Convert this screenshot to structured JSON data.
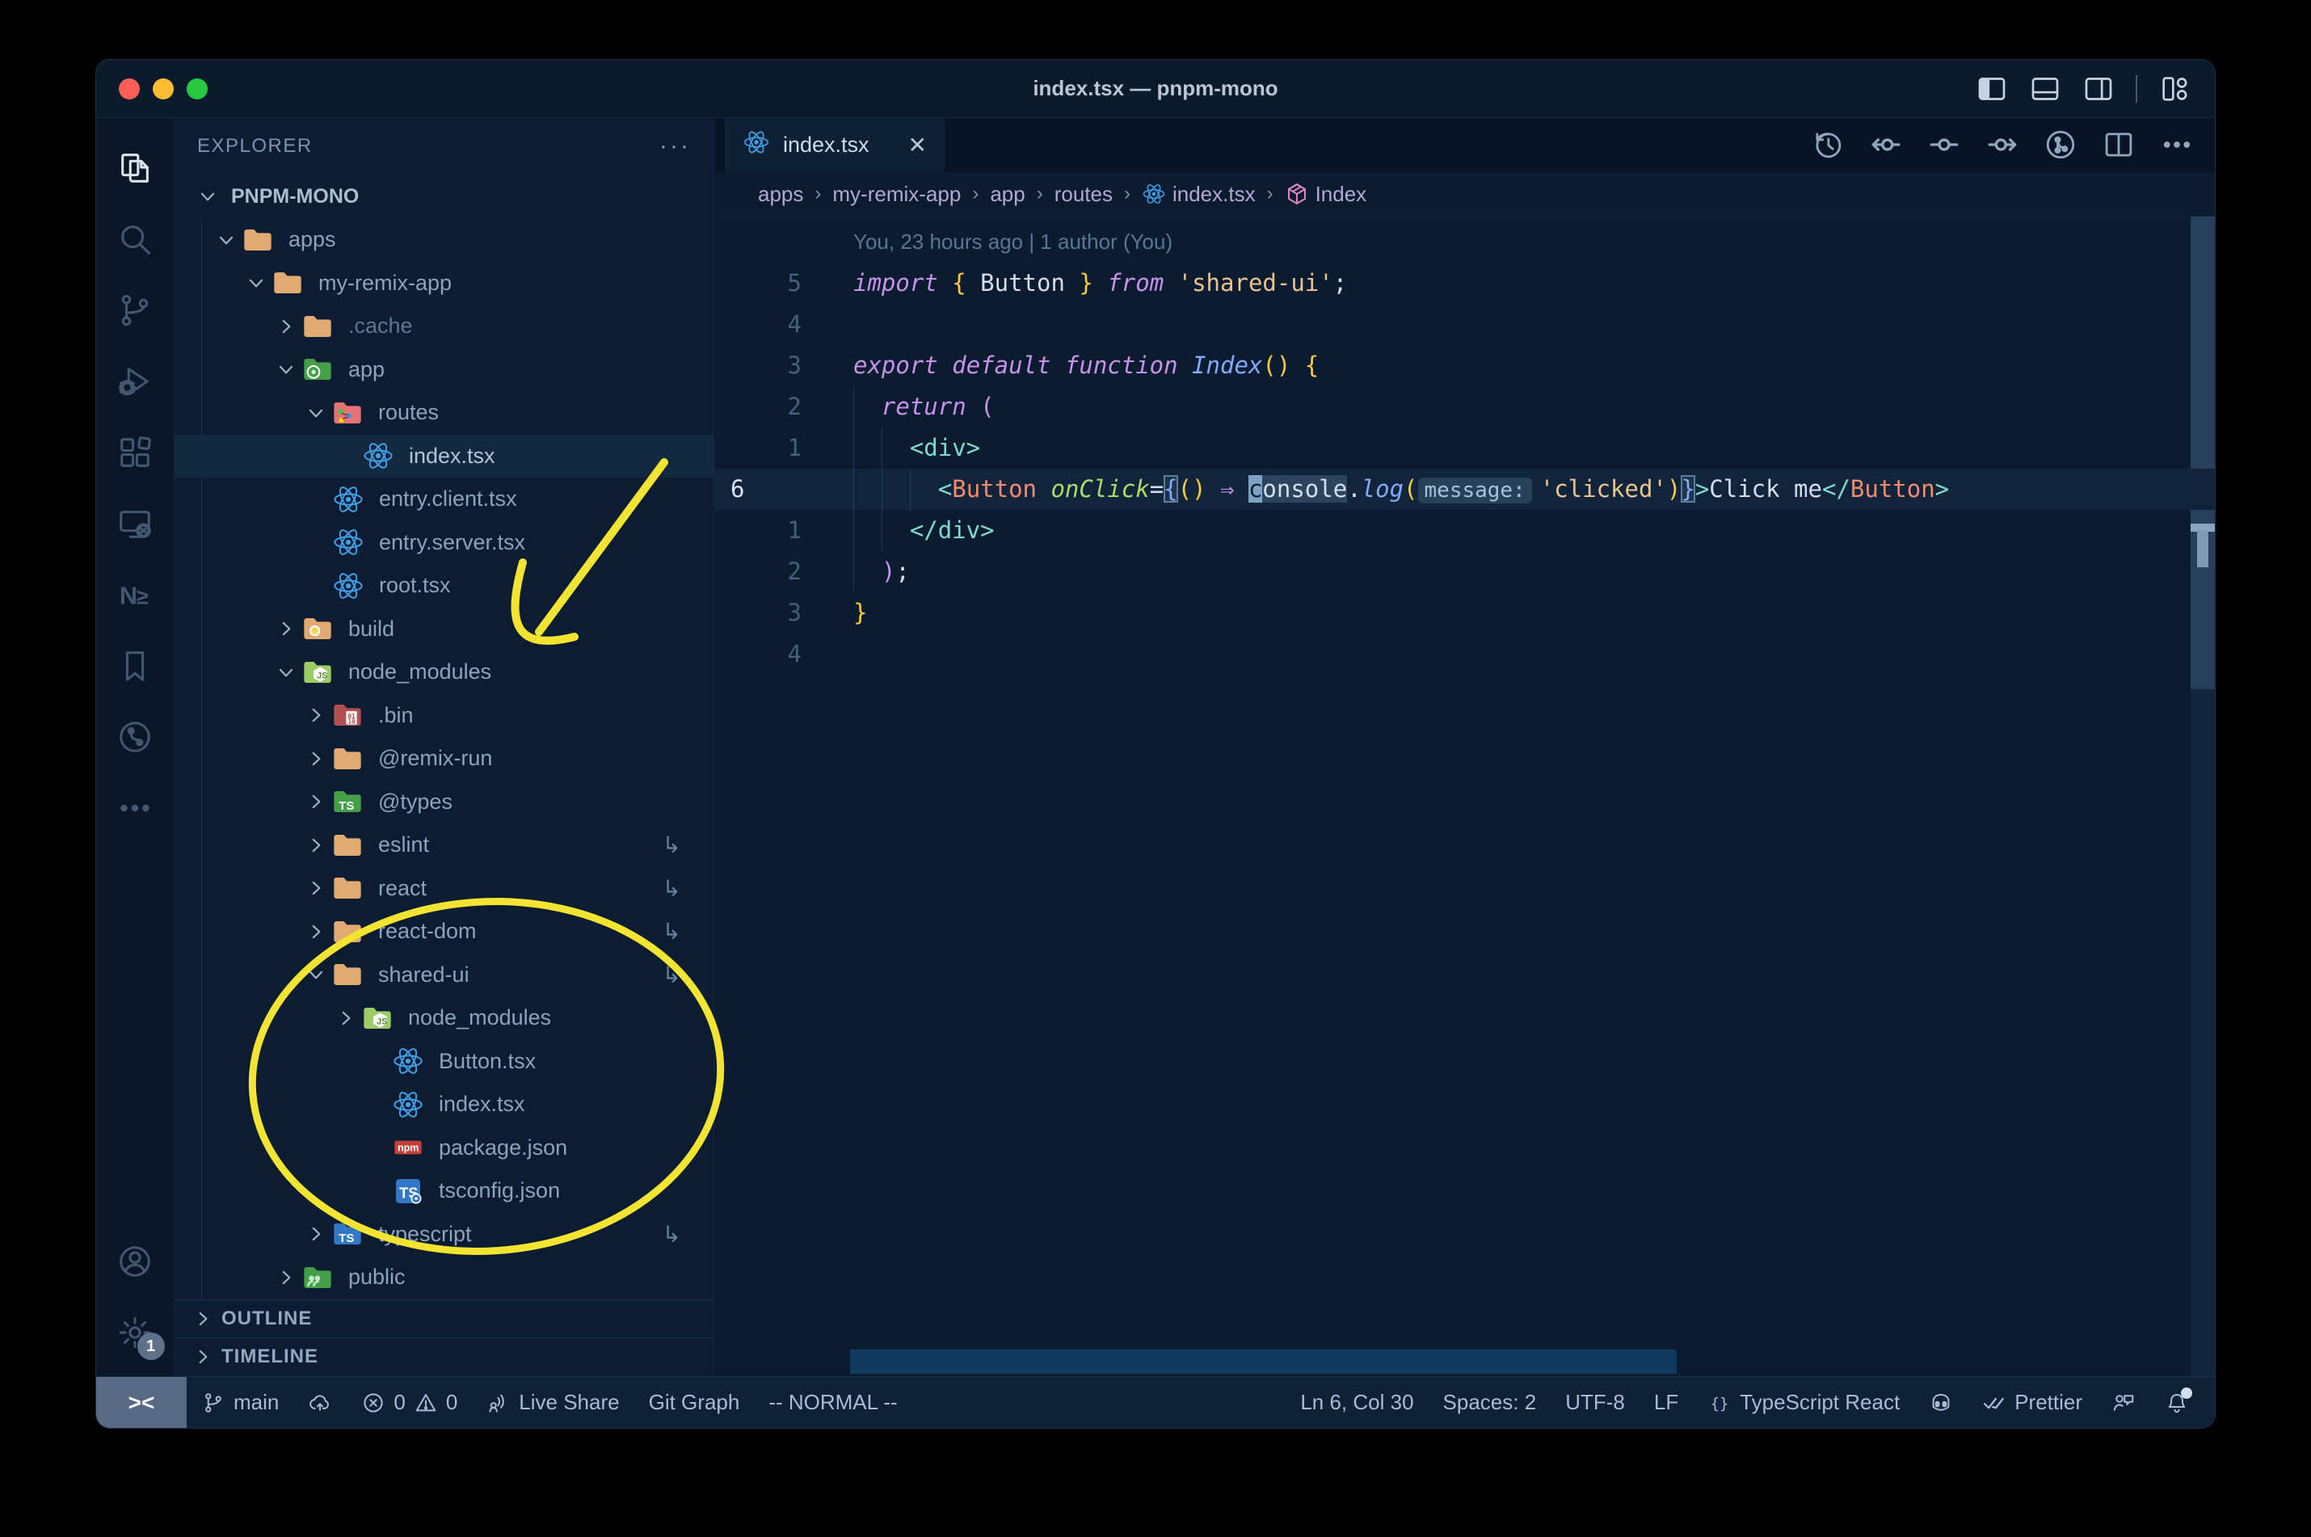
{
  "window": {
    "title": "index.tsx — pnpm-mono"
  },
  "titlebar": {
    "layout_icons": [
      "toggle-primary-sidebar-icon",
      "toggle-panel-icon",
      "toggle-secondary-sidebar-icon",
      "divider",
      "customize-layout-icon"
    ]
  },
  "activity_bar": {
    "top": [
      {
        "name": "explorer",
        "icon": "files-icon",
        "active": true
      },
      {
        "name": "search",
        "icon": "search-icon",
        "active": false
      },
      {
        "name": "source-control",
        "icon": "source-control-icon",
        "active": false
      },
      {
        "name": "run-debug",
        "icon": "debug-icon",
        "active": false
      },
      {
        "name": "extensions",
        "icon": "extensions-icon",
        "active": false
      },
      {
        "name": "remote-explorer",
        "icon": "remote-explorer-icon",
        "active": false
      },
      {
        "name": "nx-console",
        "icon": "nx-icon",
        "active": false
      },
      {
        "name": "bookmarks",
        "icon": "bookmark-icon",
        "active": false
      },
      {
        "name": "gitlens",
        "icon": "gitlens-icon",
        "active": false
      },
      {
        "name": "more-views",
        "icon": "ellipsis-icon",
        "active": false
      }
    ],
    "bottom": [
      {
        "name": "account",
        "icon": "account-icon",
        "active": false
      },
      {
        "name": "settings",
        "icon": "gear-icon",
        "active": false,
        "badge": "1"
      }
    ]
  },
  "sidebar": {
    "header": "EXPLORER",
    "header_more": "···",
    "root": "PNPM-MONO",
    "tree": [
      {
        "label": "apps",
        "icon": "folder-tan",
        "level": 1,
        "chevron": "open"
      },
      {
        "label": "my-remix-app",
        "icon": "folder-tan",
        "level": 2,
        "chevron": "open"
      },
      {
        "label": ".cache",
        "icon": "folder-tan",
        "level": 3,
        "chevron": "closed",
        "dim": true
      },
      {
        "label": "app",
        "icon": "folder-app",
        "level": 3,
        "chevron": "open"
      },
      {
        "label": "routes",
        "icon": "folder-routes",
        "level": 4,
        "chevron": "open"
      },
      {
        "label": "index.tsx",
        "icon": "react-icon",
        "level": 4,
        "file": true,
        "selected": true
      },
      {
        "label": "entry.client.tsx",
        "icon": "react-icon",
        "level": 3,
        "file": true
      },
      {
        "label": "entry.server.tsx",
        "icon": "react-icon",
        "level": 3,
        "file": true
      },
      {
        "label": "root.tsx",
        "icon": "react-icon",
        "level": 3,
        "file": true
      },
      {
        "label": "build",
        "icon": "folder-build",
        "level": 3,
        "chevron": "closed"
      },
      {
        "label": "node_modules",
        "icon": "folder-node",
        "level": 3,
        "chevron": "open"
      },
      {
        "label": ".bin",
        "icon": "folder-bin",
        "level": 4,
        "chevron": "closed"
      },
      {
        "label": "@remix-run",
        "icon": "folder-tan",
        "level": 4,
        "chevron": "closed"
      },
      {
        "label": "@types",
        "icon": "folder-types",
        "level": 4,
        "chevron": "closed"
      },
      {
        "label": "eslint",
        "icon": "folder-tan",
        "level": 4,
        "chevron": "closed",
        "symlink": true
      },
      {
        "label": "react",
        "icon": "folder-tan",
        "level": 4,
        "chevron": "closed",
        "symlink": true
      },
      {
        "label": "react-dom",
        "icon": "folder-tan",
        "level": 4,
        "chevron": "closed",
        "symlink": true
      },
      {
        "label": "shared-ui",
        "icon": "folder-tan",
        "level": 4,
        "chevron": "open",
        "symlink": true
      },
      {
        "label": "node_modules",
        "icon": "folder-node",
        "level": 5,
        "chevron": "closed"
      },
      {
        "label": "Button.tsx",
        "icon": "react-icon",
        "level": 5,
        "file": true
      },
      {
        "label": "index.tsx",
        "icon": "react-icon",
        "level": 5,
        "file": true
      },
      {
        "label": "package.json",
        "icon": "npm-icon",
        "level": 5,
        "file": true
      },
      {
        "label": "tsconfig.json",
        "icon": "tsconfig-icon",
        "level": 5,
        "file": true
      },
      {
        "label": "typescript",
        "icon": "folder-ts",
        "level": 4,
        "chevron": "closed",
        "symlink": true
      },
      {
        "label": "public",
        "icon": "folder-public",
        "level": 3,
        "chevron": "closed"
      }
    ],
    "symlink_glyph": "↳",
    "sections": [
      "OUTLINE",
      "TIMELINE"
    ]
  },
  "editor": {
    "tab": {
      "label": "index.tsx",
      "icon": "react-icon",
      "close": "✕"
    },
    "toolbar": [
      "history-icon",
      "prev-change-icon",
      "current-change-icon",
      "next-change-icon",
      "git-graph-circle-icon",
      "split-editor-icon",
      "more-actions-icon"
    ],
    "breadcrumbs": [
      {
        "label": "apps"
      },
      {
        "label": "my-remix-app"
      },
      {
        "label": "app"
      },
      {
        "label": "routes"
      },
      {
        "label": "index.tsx",
        "icon": "react-icon"
      },
      {
        "label": "Index",
        "icon": "symbol-module-icon"
      }
    ],
    "blame": "You, 23 hours ago | 1 author (You)",
    "lines": [
      {
        "num": "5",
        "tokens": [
          [
            "kw",
            "import"
          ],
          [
            "txt",
            " "
          ],
          [
            "gold",
            "{"
          ],
          [
            "txt",
            " Button "
          ],
          [
            "gold",
            "}"
          ],
          [
            "txt",
            " "
          ],
          [
            "kw",
            "from"
          ],
          [
            "txt",
            " "
          ],
          [
            "str",
            "'shared-ui'"
          ],
          [
            "txt",
            ";"
          ]
        ]
      },
      {
        "num": "4",
        "tokens": []
      },
      {
        "num": "3",
        "tokens": [
          [
            "kw",
            "export"
          ],
          [
            "txt",
            " "
          ],
          [
            "kw",
            "default"
          ],
          [
            "txt",
            " "
          ],
          [
            "kw",
            "function"
          ],
          [
            "txt",
            " "
          ],
          [
            "fn",
            "Index"
          ],
          [
            "gold",
            "()"
          ],
          [
            "txt",
            " "
          ],
          [
            "gold",
            "{"
          ]
        ]
      },
      {
        "num": "2",
        "tokens": [
          [
            "txt",
            "  "
          ],
          [
            "kw",
            "return"
          ],
          [
            "txt",
            " "
          ],
          [
            "pink",
            "("
          ]
        ]
      },
      {
        "num": "1",
        "tokens": [
          [
            "txt",
            "    "
          ],
          [
            "tag",
            "<div>"
          ]
        ]
      },
      {
        "num": "6",
        "current": true,
        "tokens": [
          [
            "txt",
            "      "
          ],
          [
            "tag",
            "<"
          ],
          [
            "cmp",
            "Button"
          ],
          [
            "txt",
            " "
          ],
          [
            "attr",
            "onClick"
          ],
          [
            "txt",
            "="
          ],
          [
            "boxb",
            "{"
          ],
          [
            "gold",
            "()"
          ],
          [
            "txt",
            " "
          ],
          [
            "pink",
            "⇒"
          ],
          [
            "txt",
            " "
          ],
          [
            "cursor",
            "c"
          ],
          [
            "hl",
            "onsole"
          ],
          [
            "txt",
            "."
          ],
          [
            "fn",
            "log"
          ],
          [
            "gold",
            "("
          ],
          [
            "inlay",
            "message:"
          ],
          [
            "str",
            "'clicked'"
          ],
          [
            "gold",
            ")"
          ],
          [
            "boxb",
            "}"
          ],
          [
            "tag",
            ">"
          ],
          [
            "txt",
            "Click me"
          ],
          [
            "tag",
            "</"
          ],
          [
            "cmp",
            "Button"
          ],
          [
            "tag",
            ">"
          ]
        ]
      },
      {
        "num": "1",
        "tokens": [
          [
            "txt",
            "    "
          ],
          [
            "tag",
            "</div>"
          ]
        ]
      },
      {
        "num": "2",
        "tokens": [
          [
            "txt",
            "  "
          ],
          [
            "pink",
            ")"
          ],
          [
            "txt",
            ";"
          ]
        ]
      },
      {
        "num": "3",
        "tokens": [
          [
            "gold",
            "}"
          ]
        ]
      },
      {
        "num": "4",
        "tokens": []
      }
    ]
  },
  "status_bar": {
    "left": [
      {
        "name": "remote-indicator",
        "icon": null,
        "label": "><"
      },
      {
        "name": "git-branch",
        "icon": "branch-icon",
        "label": "main"
      },
      {
        "name": "sync-changes",
        "icon": "cloud-upload-icon",
        "label": ""
      },
      {
        "name": "problems",
        "icon": "error-icon",
        "label": "0",
        "icon2": "warning-icon",
        "label2": "0"
      },
      {
        "name": "live-share",
        "icon": "live-share-icon",
        "label": "Live Share"
      },
      {
        "name": "git-graph",
        "icon": null,
        "label": "Git Graph"
      },
      {
        "name": "vim-mode",
        "icon": null,
        "label": "-- NORMAL --"
      }
    ],
    "right": [
      {
        "name": "cursor-position",
        "icon": null,
        "label": "Ln 6, Col 30"
      },
      {
        "name": "indentation",
        "icon": null,
        "label": "Spaces: 2"
      },
      {
        "name": "encoding",
        "icon": null,
        "label": "UTF-8"
      },
      {
        "name": "eol",
        "icon": null,
        "label": "LF"
      },
      {
        "name": "language-mode",
        "icon": "braces-icon",
        "label": "TypeScript React"
      },
      {
        "name": "copilot",
        "icon": "copilot-icon",
        "label": ""
      },
      {
        "name": "prettier",
        "icon": "double-check-icon",
        "label": "Prettier"
      },
      {
        "name": "feedback",
        "icon": "feedback-icon",
        "label": ""
      },
      {
        "name": "notifications",
        "icon": "bell-icon",
        "label": ""
      }
    ]
  },
  "annotations": {
    "color": "#f2e431"
  }
}
